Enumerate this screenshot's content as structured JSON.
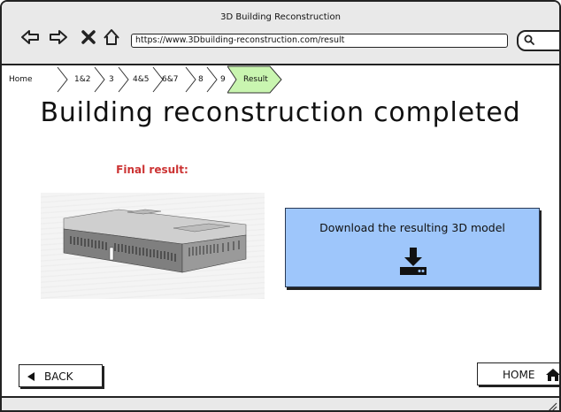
{
  "window": {
    "title": "3D Building Reconstruction"
  },
  "browser": {
    "url": "https://www.3Dbuilding-reconstruction.com/result",
    "nav_icons": [
      "back-arrow-icon",
      "forward-arrow-icon",
      "close-icon",
      "home-icon"
    ],
    "search_icon": "search-icon"
  },
  "breadcrumb": {
    "items": [
      "Home",
      "1&2",
      "3",
      "4&5",
      "6&7",
      "8",
      "9",
      "Result"
    ],
    "active": "Result",
    "active_color": "#c9f5b0"
  },
  "main": {
    "heading": "Building reconstruction completed",
    "final_label": "Final result:",
    "final_label_color": "#cc3333",
    "download_text": "Download the resulting 3D model",
    "download_icon": "download-icon",
    "panel_color": "#9ec6fb"
  },
  "footer": {
    "back_label": "BACK",
    "home_label": "HOME"
  }
}
